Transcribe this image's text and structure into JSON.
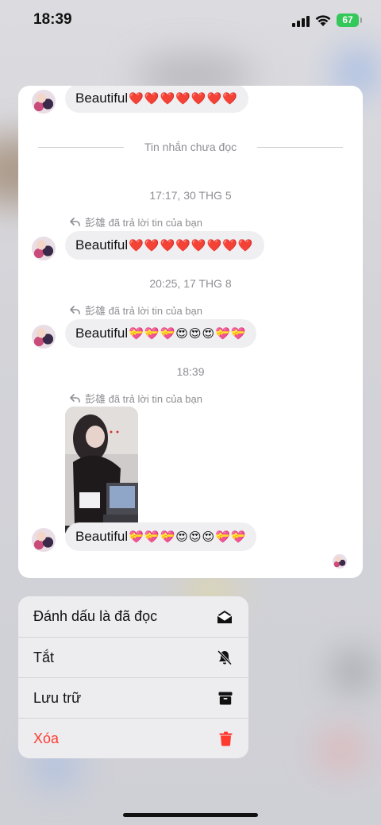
{
  "status_bar": {
    "time": "18:39",
    "battery": "67"
  },
  "card": {
    "top_message": {
      "text": "Beautiful",
      "emoji": "❤️❤️❤️❤️❤️❤️❤️"
    },
    "unread_divider": "Tin nhắn chưa đọc",
    "groups": [
      {
        "timestamp": "17:17, 30 THG 5",
        "reply_label": "彭雄 đã trả lời tin của bạn",
        "message": "Beautiful",
        "emoji": "❤️❤️❤️❤️❤️❤️❤️❤️"
      },
      {
        "timestamp": "20:25, 17 THG 8",
        "reply_label": "彭雄 đã trả lời tin của bạn",
        "message": "Beautiful",
        "emoji": "💝💝💝😍😍😍💝💝"
      },
      {
        "timestamp": "18:39",
        "reply_label": "彭雄 đã trả lời tin của bạn",
        "message": "Beautiful",
        "emoji": "💝💝💝😍😍😍💝💝"
      }
    ]
  },
  "menu": {
    "items": [
      {
        "label": "Đánh dấu là đã đọc",
        "icon": "envelope-open-icon"
      },
      {
        "label": "Tắt",
        "icon": "bell-slash-icon"
      },
      {
        "label": "Lưu trữ",
        "icon": "archive-box-icon"
      },
      {
        "label": "Xóa",
        "icon": "trash-icon",
        "color": "#ff3b30"
      }
    ]
  },
  "colors": {
    "danger": "#ff3b30",
    "bubble": "#efeff2",
    "battery": "#34c759"
  }
}
